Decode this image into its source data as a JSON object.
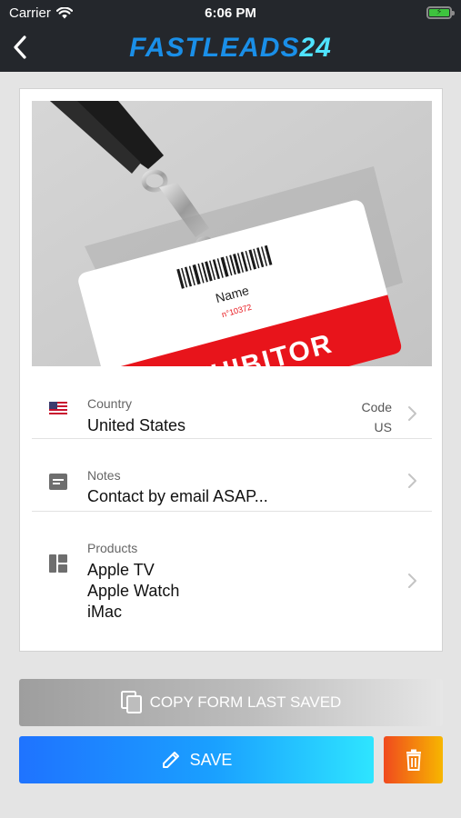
{
  "status_bar": {
    "carrier": "Carrier",
    "time": "6:06 PM",
    "battery_color": "#3ec33e"
  },
  "nav": {
    "back_icon": "chevron-left-icon",
    "brand_part1": "FASTLEADS",
    "brand_part2": "24",
    "brand_color": "#1a8fe8",
    "brand_accent": "#4fe3ff"
  },
  "badge": {
    "name_text": "Name",
    "number_text": "n°10372",
    "role_text": "EXHIBITOR",
    "role_color": "#e8141b"
  },
  "rows": {
    "country": {
      "label": "Country",
      "value": "United States",
      "code_label": "Code",
      "code_value": "US",
      "icon": "us-flag-icon"
    },
    "notes": {
      "label": "Notes",
      "value": "Contact by email ASAP...",
      "icon": "notes-icon"
    },
    "products": {
      "label": "Products",
      "items": [
        "Apple TV",
        "Apple Watch",
        "iMac"
      ],
      "icon": "dashboard-icon"
    }
  },
  "actions": {
    "copy_label": "COPY FORM LAST SAVED",
    "save_label": "SAVE",
    "delete_icon": "trash-icon"
  }
}
